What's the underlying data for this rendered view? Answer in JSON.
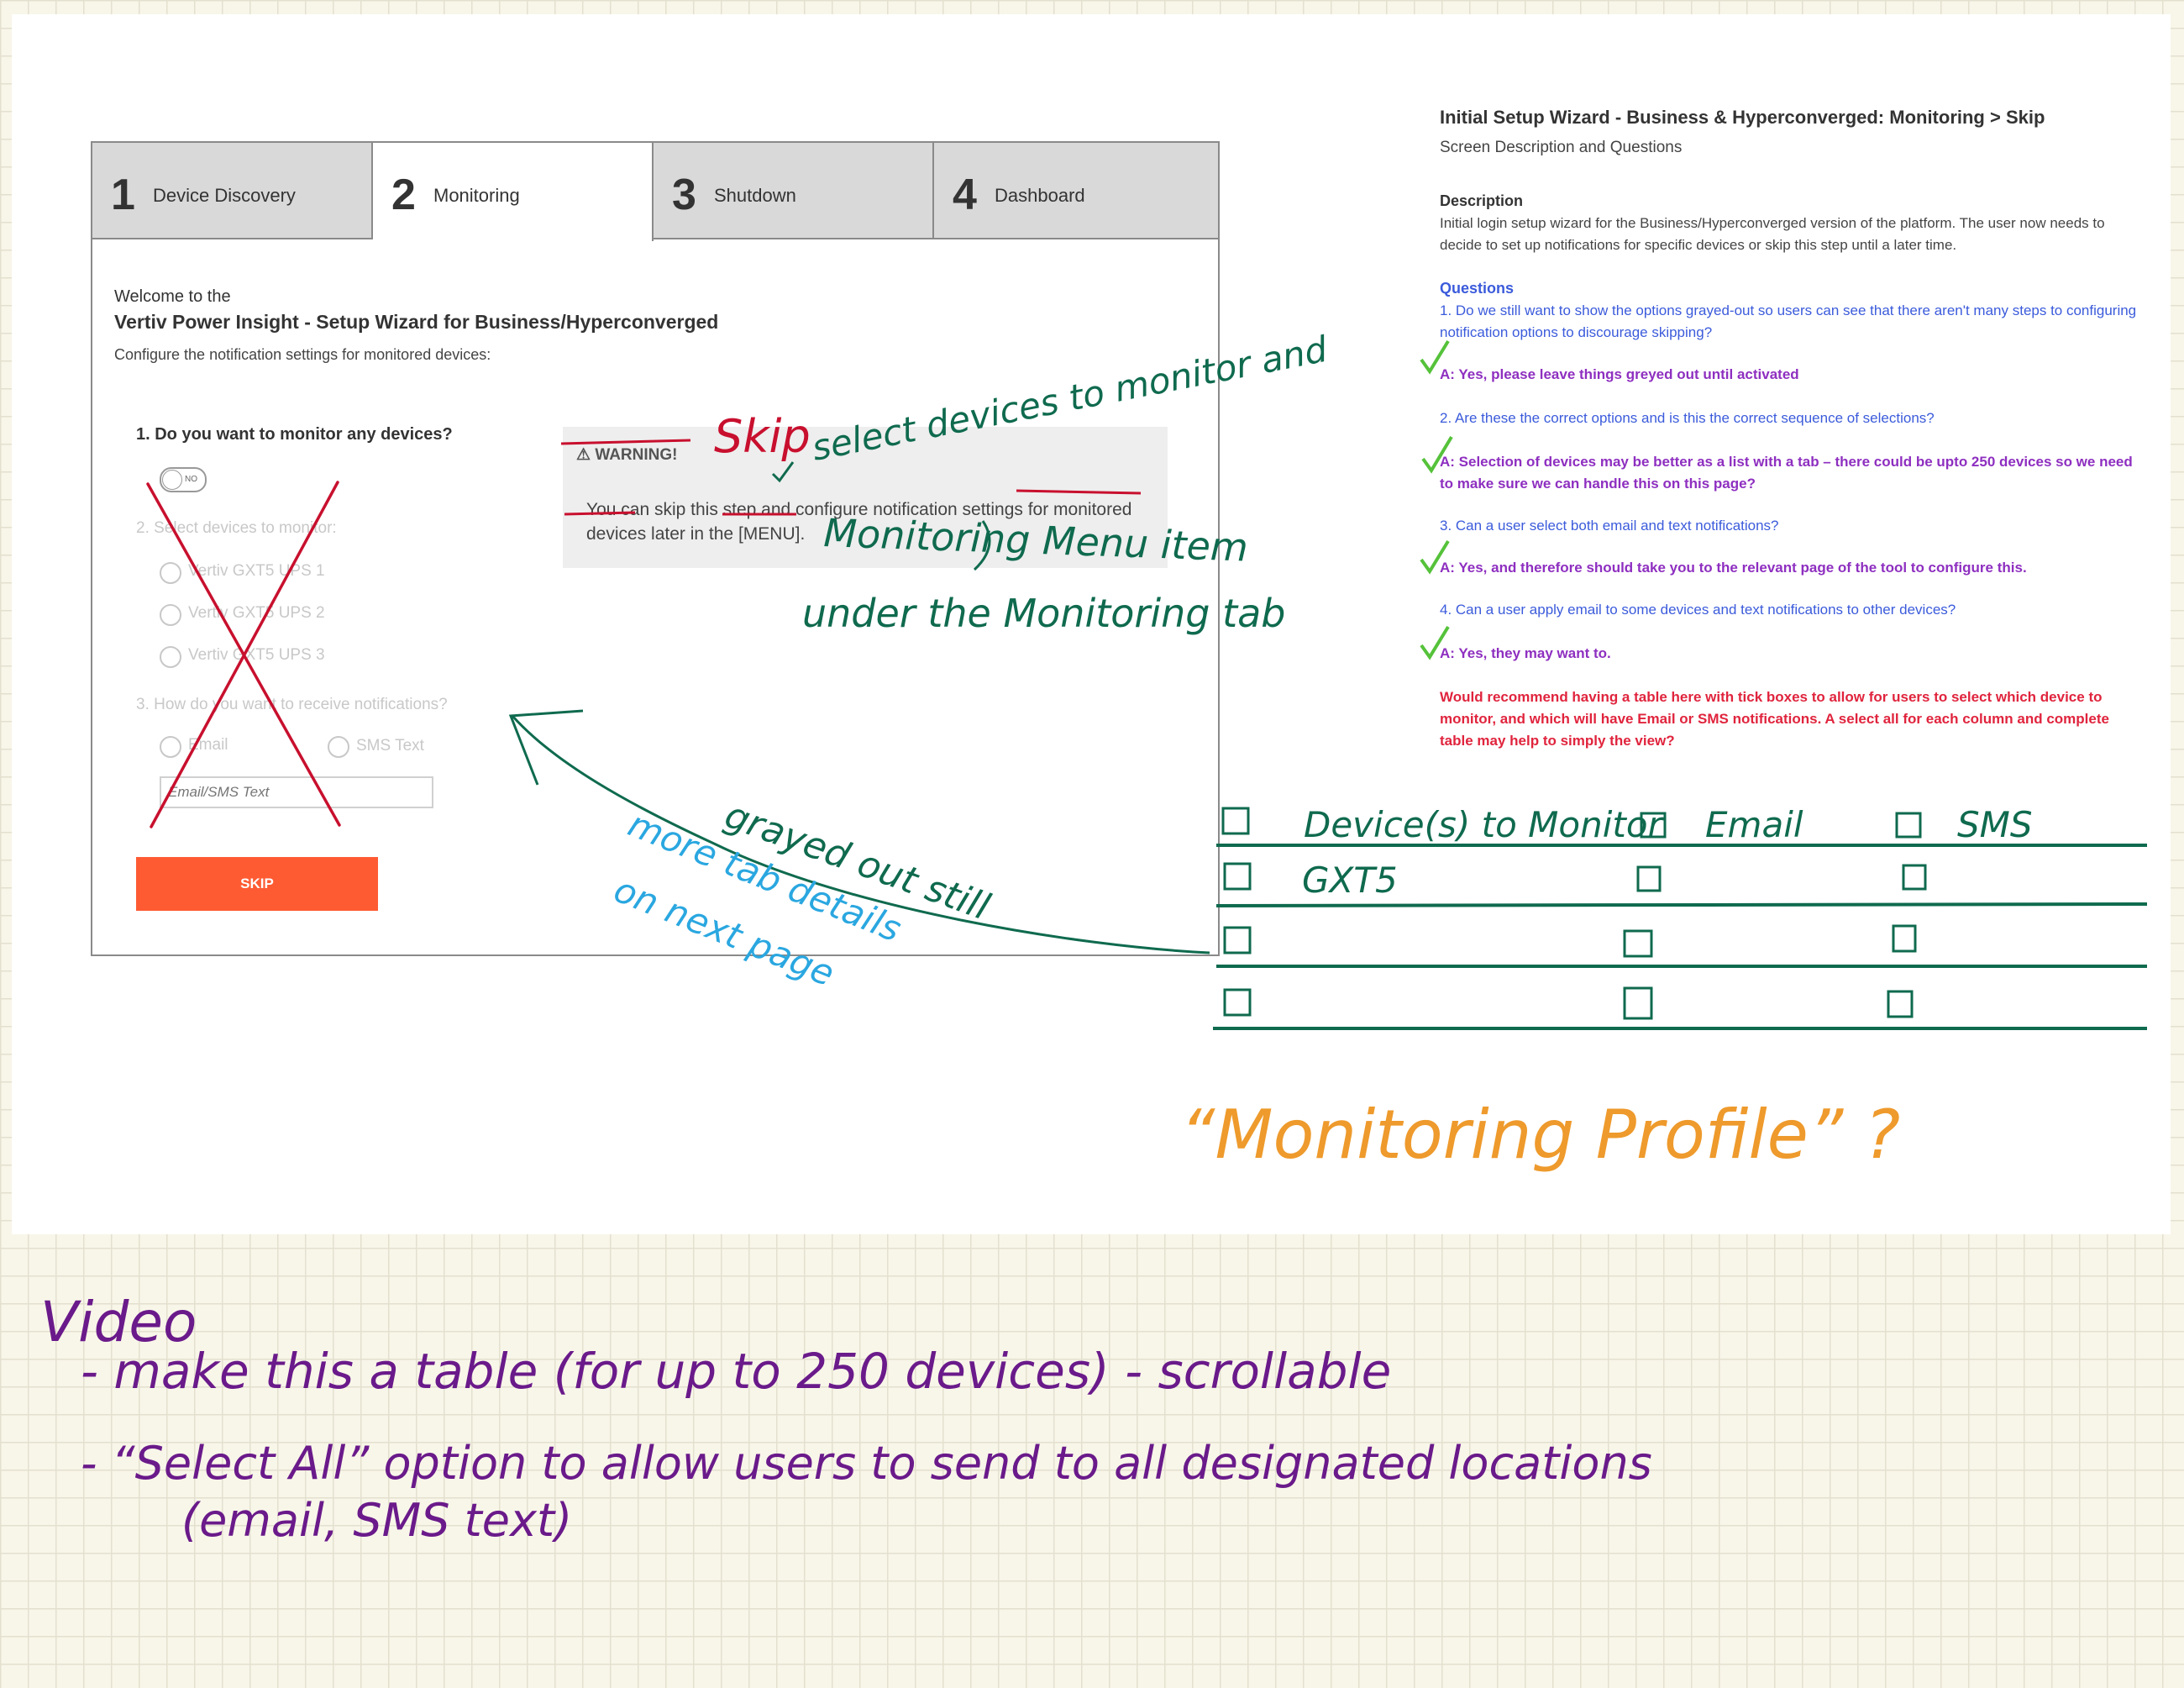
{
  "wizard": {
    "tabs": [
      {
        "num": "1",
        "label": "Device Discovery"
      },
      {
        "num": "2",
        "label": "Monitoring"
      },
      {
        "num": "3",
        "label": "Shutdown"
      },
      {
        "num": "4",
        "label": "Dashboard"
      }
    ],
    "active_tab": 2,
    "welcome": "Welcome to the",
    "title": "Vertiv Power Insight - Setup Wizard for Business/Hyperconverged",
    "subtitle": "Configure the notification settings for monitored devices:",
    "q1": "1.  Do you want to monitor any devices?",
    "toggle_label": "NO",
    "q2": "2. Select devices to monitor:",
    "devices": [
      "Vertiv GXT5 UPS 1",
      "Vertiv GXT5 UPS 2",
      "Vertiv GXT5 UPS 3"
    ],
    "q3": "3.  How do you want to receive notifications?",
    "notify_options": [
      "Email",
      "SMS Text"
    ],
    "input_placeholder": "Email/SMS Text",
    "skip_label": "SKIP",
    "warning": {
      "heading": "WARNING!",
      "body_start": "You can skip this step and configure notification settings ",
      "body_struck1": "for monitored devices",
      "body_mid": " later in the ",
      "body_struck2": "[MENU]."
    }
  },
  "panel": {
    "title": "Initial Setup Wizard - Business & Hyperconverged: Monitoring > Skip",
    "subtitle": "Screen Description and Questions",
    "description_heading": "Description",
    "description": "Initial login setup wizard for the Business/Hyperconverged version of the platform.  The user now needs to decide to set up notifications for specific devices or skip this step until a later time.",
    "questions_heading": "Questions",
    "qa": [
      {
        "q": "1.  Do we still want to show the options grayed-out so users can see that there aren't many steps to configuring notification options to discourage skipping?",
        "a": "A: Yes, please leave things greyed out until activated"
      },
      {
        "q": "2.  Are these the correct options and is this the correct sequence of selections?",
        "a": "A: Selection of devices may be better as a list with a tab – there could be upto 250 devices so we need to make sure we can handle this on this page?"
      },
      {
        "q": "3.  Can a user select both email and text notifications?",
        "a": "A: Yes, and therefore should take you to the relevant page of the tool to configure this."
      },
      {
        "q": "4.  Can a user apply email to some devices and text notifications to other devices?",
        "a": "A: Yes, they may want to."
      }
    ],
    "recommendation": "Would recommend having a table here with tick boxes to allow for users to select which device to monitor, and which will have Email or SMS notifications. A select all for each column and complete table may help to simply the view?"
  },
  "annotations": {
    "skip_word": "Skip",
    "replacement_1": "select devices to monitor and",
    "replacement_2": "Monitoring Menu item",
    "replacement_3": "under the Monitoring tab",
    "grayed_note": "grayed out still",
    "more_note_1": "more tab details",
    "more_note_2": "on next page",
    "table_headers": [
      "Device(s) to Monitor",
      "Email",
      "SMS"
    ],
    "table_rows": [
      "GXT5"
    ],
    "profile_note": "“Monitoring Profile” ?",
    "video_heading": "Video",
    "video_line1": "- make this a table (for up to 250 devices) - scrollable",
    "video_line2": "- “Select All” option to allow users to send to all designated locations",
    "video_line3": "(email, SMS text)"
  },
  "colors": {
    "ink_green": "#0f6a4e",
    "ink_red": "#c8102e",
    "ink_cyan": "#2aa7e0",
    "ink_orange": "#ee9a2c",
    "ink_purple": "#6a1a8a",
    "skip_button": "#fe5b33",
    "check_green": "#55c23a"
  }
}
